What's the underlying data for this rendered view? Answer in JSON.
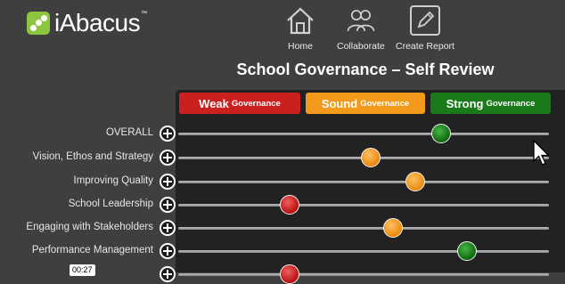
{
  "app": {
    "logo_text": "iAbacus",
    "trademark": "™",
    "logo_color": "#8cc63f"
  },
  "nav": [
    {
      "label": "Home",
      "icon": "home-icon"
    },
    {
      "label": "Collaborate",
      "icon": "users-icon"
    },
    {
      "label": "Create Report",
      "icon": "edit-report-icon"
    }
  ],
  "page_title": "School Governance – Self Review",
  "scale": {
    "weak": {
      "main": "Weak",
      "sub": "Governance",
      "color": "#cc1f1f"
    },
    "sound": {
      "main": "Sound",
      "sub": "Governance",
      "color": "#f39a1c"
    },
    "strong": {
      "main": "Strong",
      "sub": "Governance",
      "color": "#1a7a1a"
    }
  },
  "rows": [
    {
      "label": "OVERALL",
      "rating": "strong",
      "position": 0.71
    },
    {
      "label": "Vision, Ethos and Strategy",
      "rating": "sound",
      "position": 0.52
    },
    {
      "label": "Improving Quality",
      "rating": "sound",
      "position": 0.64
    },
    {
      "label": "School Leadership",
      "rating": "weak",
      "position": 0.3
    },
    {
      "label": "Engaging with Stakeholders",
      "rating": "sound",
      "position": 0.58
    },
    {
      "label": "Performance Management",
      "rating": "strong",
      "position": 0.78
    },
    {
      "label": "",
      "rating": "weak",
      "position": 0.3
    }
  ],
  "tooltip": "00:27"
}
